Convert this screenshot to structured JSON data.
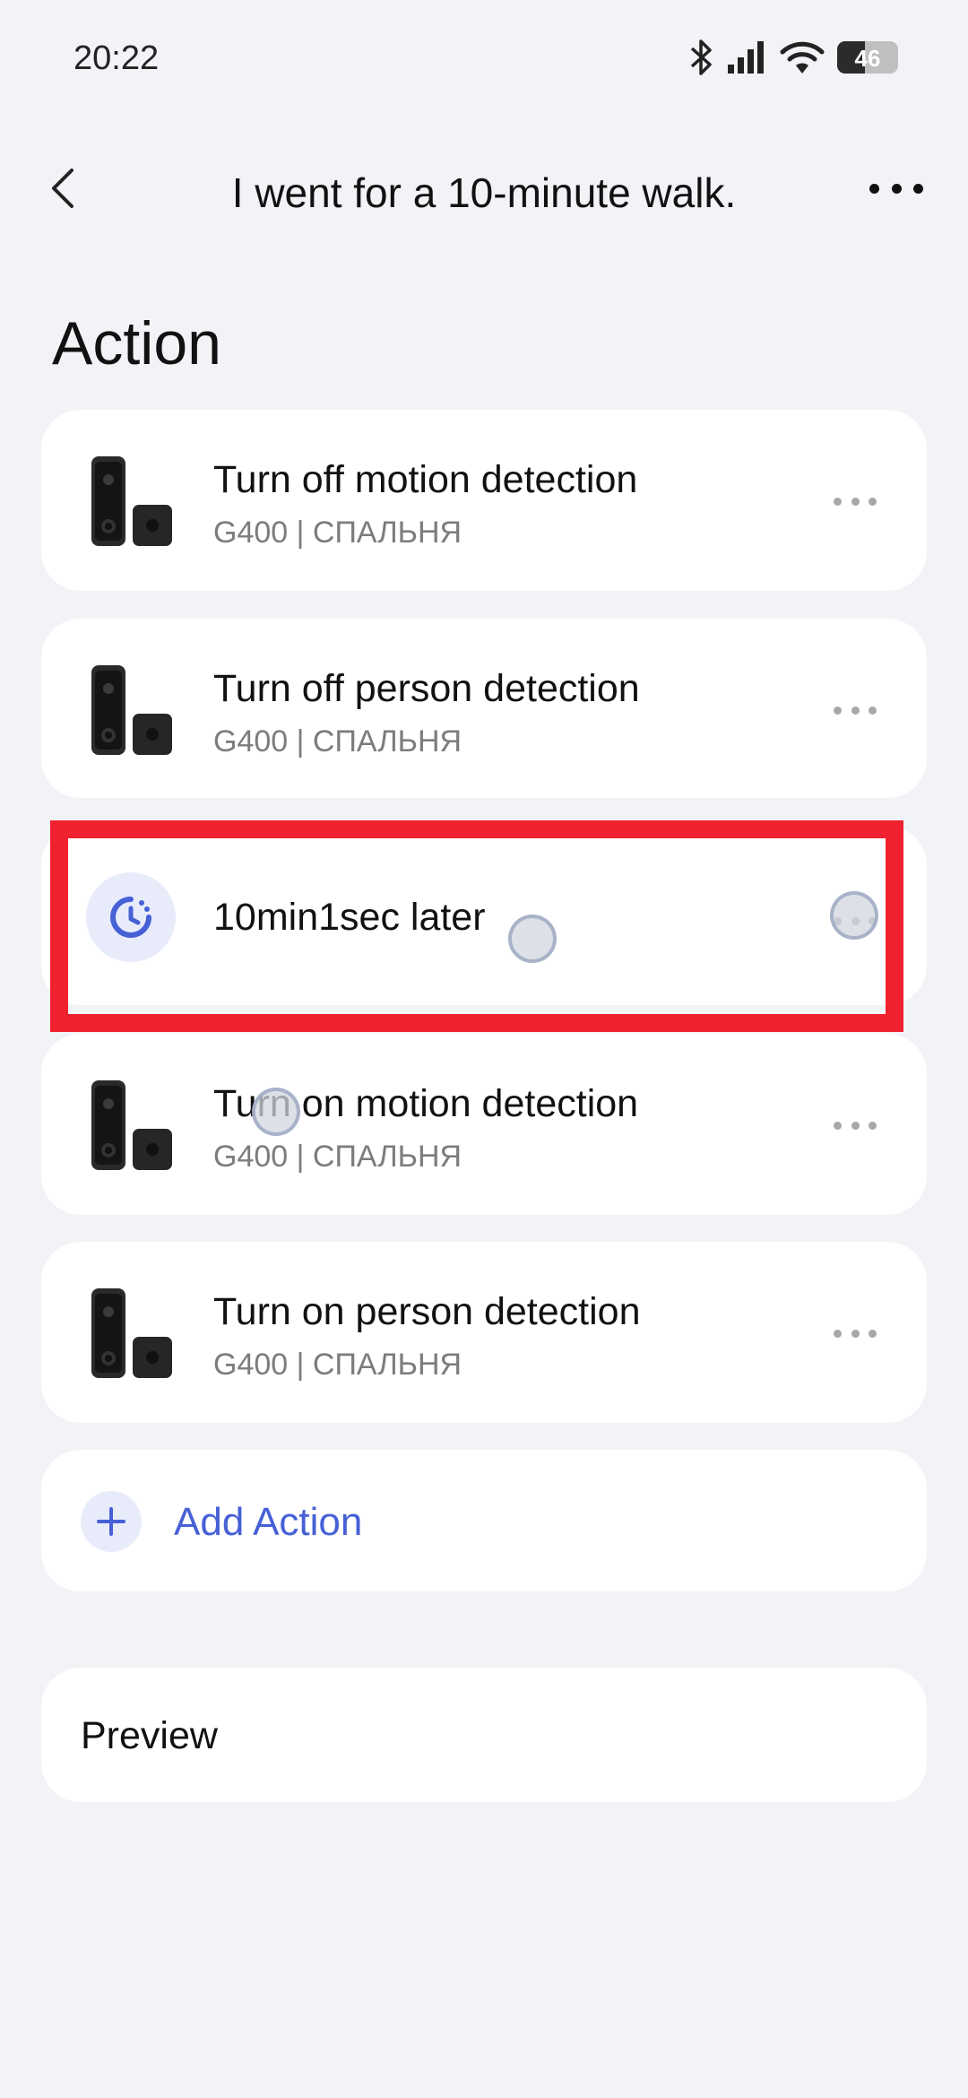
{
  "status_bar": {
    "time": "20:22",
    "battery_level": "46",
    "battery_fraction": 0.46,
    "icons": [
      "bluetooth-icon",
      "cellular-signal-icon",
      "wifi-icon",
      "battery-icon"
    ]
  },
  "header": {
    "title": "I went for a 10-minute walk.",
    "back_icon": "chevron-left-icon",
    "more_icon": "more-horizontal-icon"
  },
  "section": {
    "title": "Action"
  },
  "actions": [
    {
      "title": "Turn off motion detection",
      "subtitle": "G400 | СПАЛЬНЯ",
      "icon": "doorbell-camera-icon"
    },
    {
      "title": "Turn off person detection",
      "subtitle": "G400 | СПАЛЬНЯ",
      "icon": "doorbell-camera-icon"
    },
    {
      "title": "10min1sec later",
      "icon": "timer-icon",
      "highlighted": true
    },
    {
      "title": "Turn on motion detection",
      "subtitle": "G400 | СПАЛЬНЯ",
      "icon": "doorbell-camera-icon"
    },
    {
      "title": "Turn on person detection",
      "subtitle": "G400 | СПАЛЬНЯ",
      "icon": "doorbell-camera-icon"
    }
  ],
  "add_action": {
    "label": "Add Action",
    "icon": "plus-icon"
  },
  "preview": {
    "label": "Preview"
  },
  "colors": {
    "background": "#f2f3f7",
    "card": "#ffffff",
    "accent": "#4660d6",
    "icon_bg": "#e8ecfa",
    "highlight": "#f0222f",
    "subtitle": "#7c7c7c"
  }
}
